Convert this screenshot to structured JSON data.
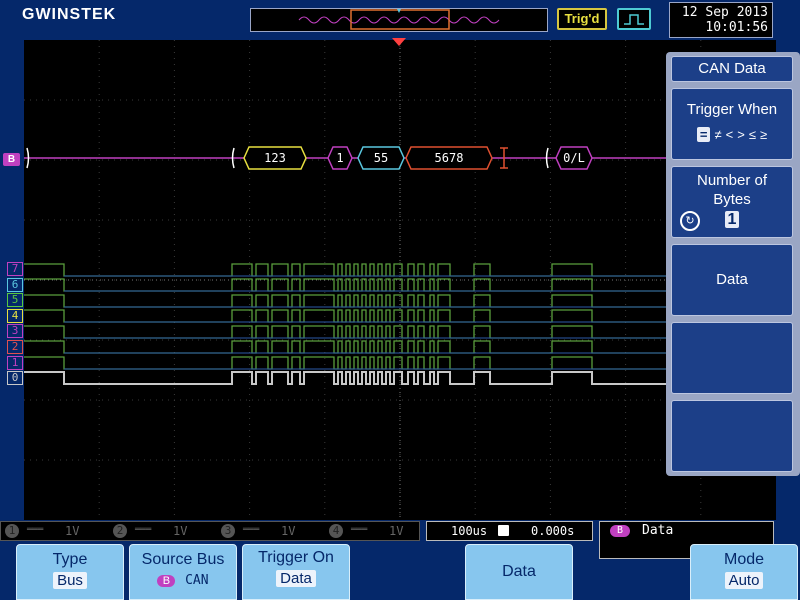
{
  "brand": {
    "logo": "GWINSTEK"
  },
  "status": {
    "trigger_state": "Trig'd",
    "date": "12 Sep 2013",
    "time": "10:01:56"
  },
  "bus": {
    "marker": "B",
    "frames": [
      "123",
      "1",
      "55",
      "5678",
      "0/L"
    ]
  },
  "channels": {
    "digital_labels": [
      "7",
      "6",
      "5",
      "4",
      "3",
      "2",
      "1",
      "0"
    ],
    "analog": [
      {
        "num": "1",
        "scale": "1V"
      },
      {
        "num": "2",
        "scale": "1V"
      },
      {
        "num": "3",
        "scale": "1V"
      },
      {
        "num": "4",
        "scale": "1V"
      }
    ]
  },
  "timebase": {
    "scale": "100us",
    "position": "0.000s"
  },
  "bus_status": {
    "badge": "B",
    "label": "Data"
  },
  "side_menu": {
    "title": "CAN Data",
    "trigger_when": {
      "label": "Trigger When",
      "options": [
        "=",
        "≠",
        "<",
        ">",
        "≤",
        "≥"
      ],
      "selected": "="
    },
    "num_bytes": {
      "label": "Number of Bytes",
      "value": "1"
    },
    "data_label": "Data"
  },
  "bottom_menu": {
    "type": {
      "label": "Type",
      "value": "Bus"
    },
    "source_bus": {
      "label": "Source Bus",
      "badge": "B",
      "value": "CAN"
    },
    "trigger_on": {
      "label": "Trigger On",
      "value": "Data"
    },
    "data": {
      "label": "Data"
    },
    "mode": {
      "label": "Mode",
      "value": "Auto"
    }
  },
  "colors": {
    "bg": "#05286a",
    "trace_green": "#5a9e3c",
    "trace_blue": "#2b5aa8",
    "trace_gray": "#c8c8c8",
    "bus_magenta": "#c040c0",
    "frame_yellow": "#e8e040",
    "frame_cyan": "#5ac8e0",
    "frame_red": "#e05030"
  }
}
